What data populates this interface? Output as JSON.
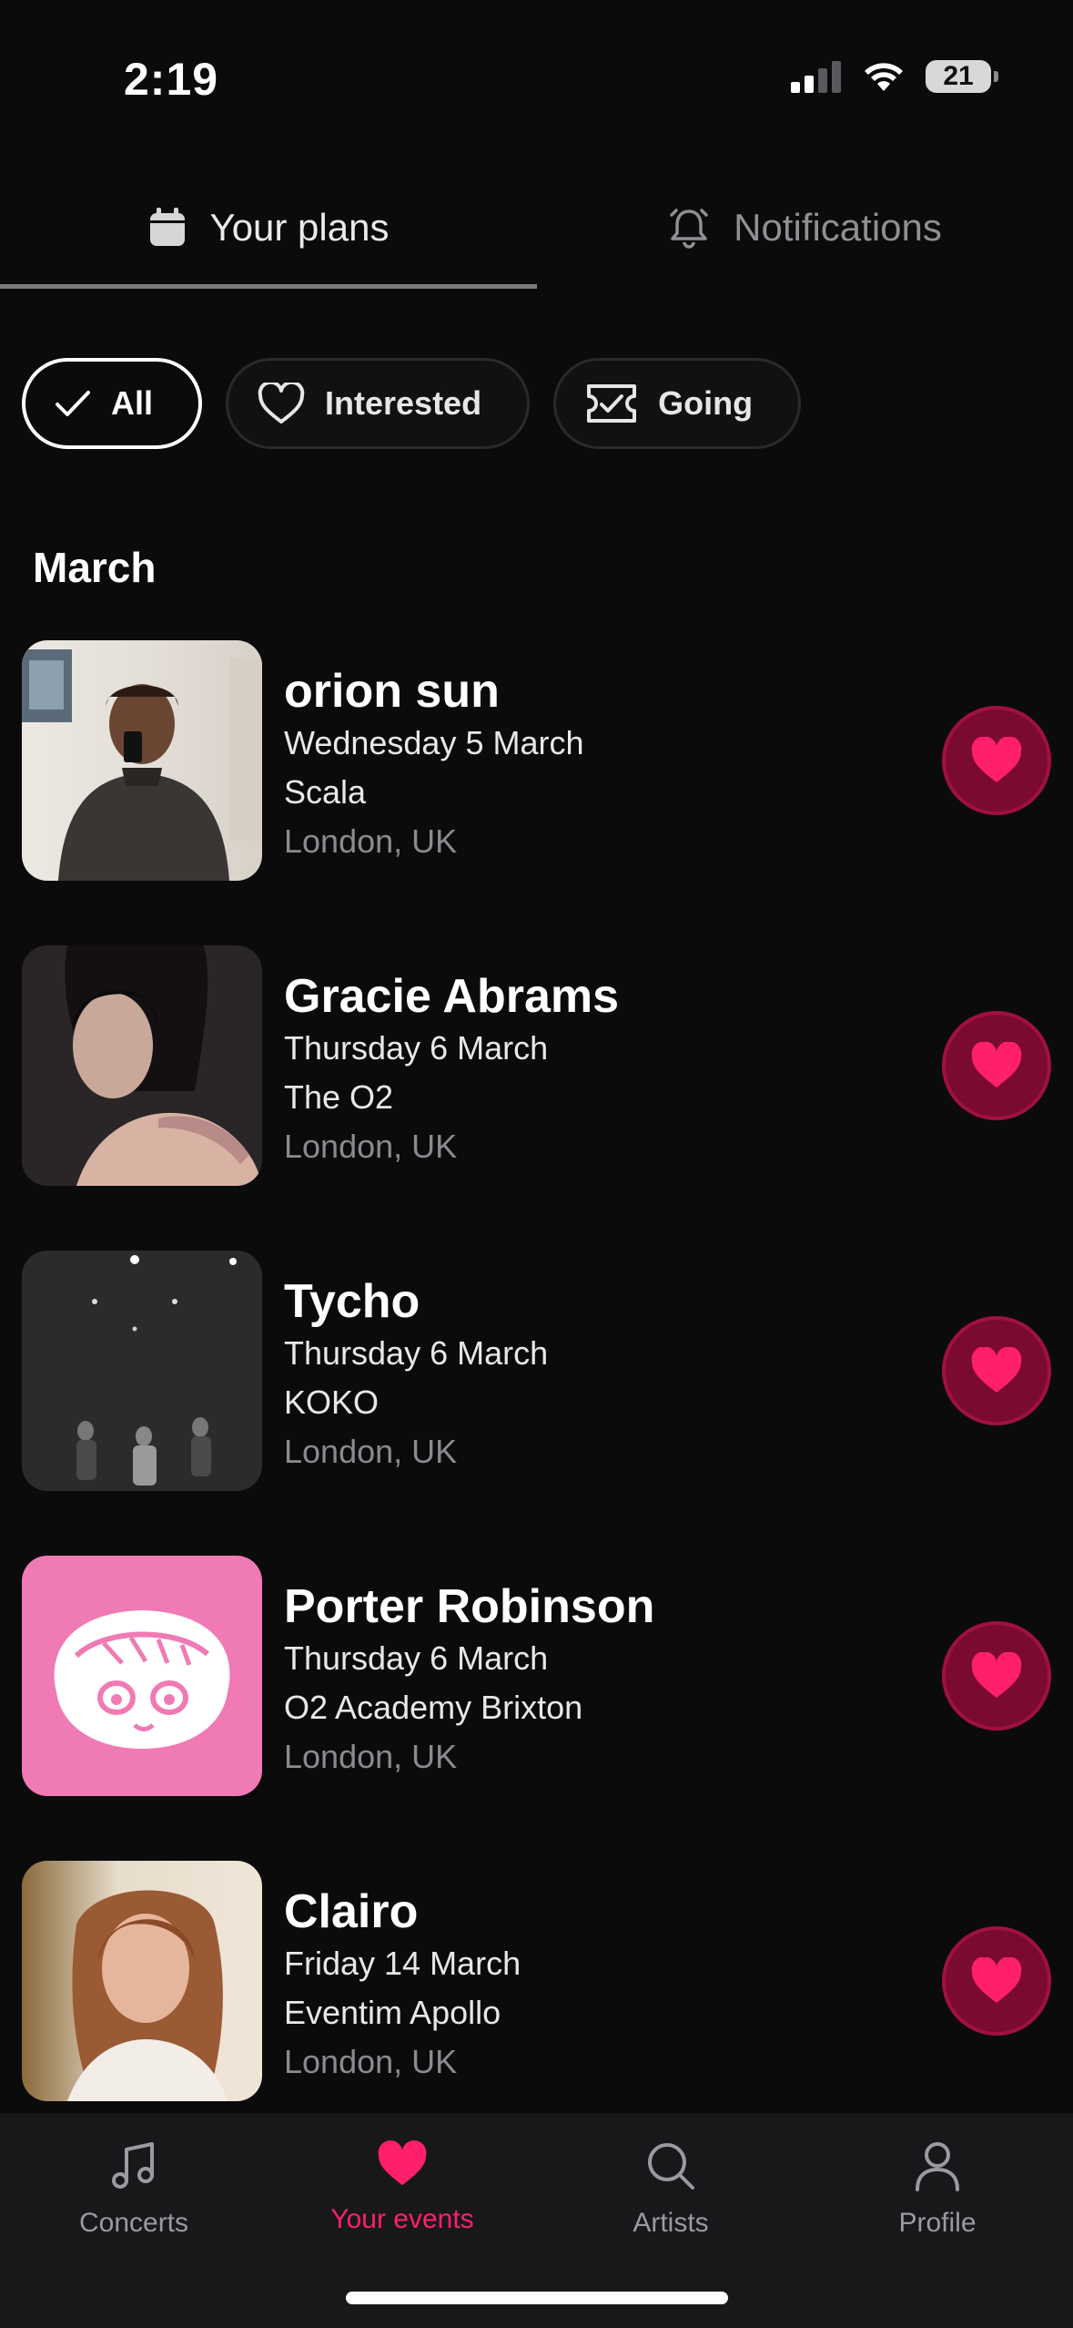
{
  "status_bar": {
    "time": "2:19",
    "battery": "21"
  },
  "tabs": [
    {
      "label": "Your plans",
      "icon": "calendar-icon",
      "active": true
    },
    {
      "label": "Notifications",
      "icon": "bell-icon",
      "active": false
    }
  ],
  "filters": [
    {
      "label": "All",
      "icon": "checkmark-icon",
      "active": true
    },
    {
      "label": "Interested",
      "icon": "heart-outline-icon",
      "active": false
    },
    {
      "label": "Going",
      "icon": "ticket-icon",
      "active": false
    }
  ],
  "section": {
    "title": "March"
  },
  "events": [
    {
      "artist": "orion sun",
      "date": "Wednesday 5 March",
      "venue": "Scala",
      "city": "London, UK"
    },
    {
      "artist": "Gracie Abrams",
      "date": "Thursday 6 March",
      "venue": "The O2",
      "city": "London, UK"
    },
    {
      "artist": "Tycho",
      "date": "Thursday 6 March",
      "venue": "KOKO",
      "city": "London, UK"
    },
    {
      "artist": "Porter Robinson",
      "date": "Thursday 6 March",
      "venue": "O2 Academy Brixton",
      "city": "London, UK"
    },
    {
      "artist": "Clairo",
      "date": "Friday 14 March",
      "venue": "Eventim Apollo",
      "city": "London, UK"
    }
  ],
  "bottom_nav": [
    {
      "label": "Concerts",
      "icon": "music-note-icon",
      "active": false
    },
    {
      "label": "Your events",
      "icon": "heart-icon",
      "active": true
    },
    {
      "label": "Artists",
      "icon": "search-icon",
      "active": false
    },
    {
      "label": "Profile",
      "icon": "person-icon",
      "active": false
    }
  ],
  "colors": {
    "accent": "#ff1f6a",
    "heart_bg": "#7a0a30",
    "background": "#0b0b0c"
  }
}
